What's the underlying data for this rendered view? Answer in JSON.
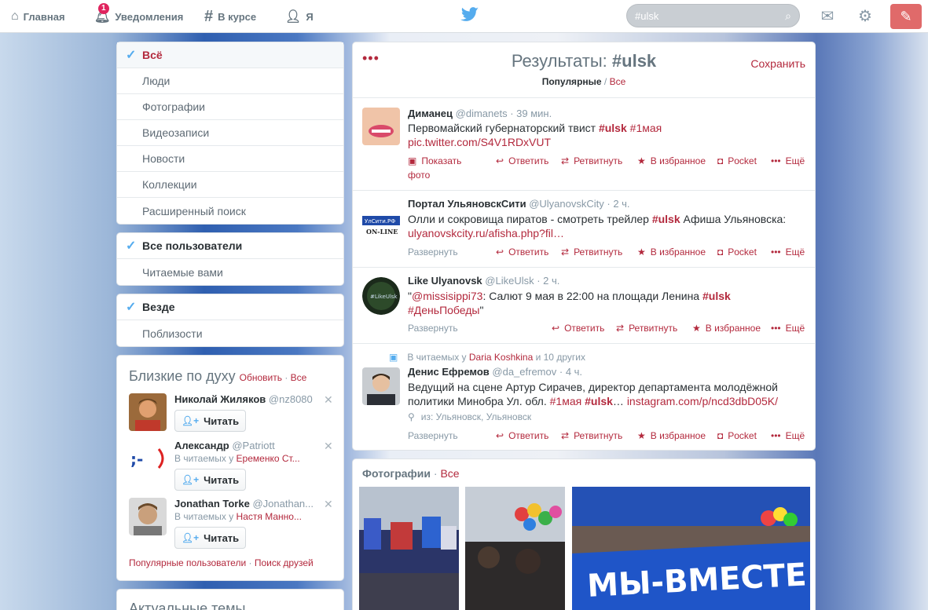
{
  "nav": {
    "home": "Главная",
    "notifications": "Уведомления",
    "notif_count": "1",
    "discover": "В курсе",
    "me": "Я",
    "search_value": "#ulsk"
  },
  "filters": {
    "type": [
      "Всё",
      "Люди",
      "Фотографии",
      "Видеозаписи",
      "Новости",
      "Коллекции",
      "Расширенный поиск"
    ],
    "people": [
      "Все пользователи",
      "Читаемые вами"
    ],
    "place": [
      "Везде",
      "Поблизости"
    ]
  },
  "wtf": {
    "title": "Близкие по духу",
    "refresh": "Обновить",
    "sep": " · ",
    "all": "Все",
    "follow": "Читать",
    "users": [
      {
        "name": "Николай Жиляков",
        "handle": "@nz8080",
        "ctx": ""
      },
      {
        "name": "Александр",
        "handle": "@Patriott",
        "ctx_prefix": "В читаемых у ",
        "ctx_name": "Еременко Ст..."
      },
      {
        "name": "Jonathan Torke",
        "handle": "@Jonathan...",
        "ctx_prefix": "В читаемых у ",
        "ctx_name": "Настя Манно..."
      }
    ],
    "footer_a": "Популярные пользователи",
    "footer_b": "Поиск друзей"
  },
  "trends_title": "Актуальные темы",
  "results": {
    "title": "Результаты: ",
    "query": "#ulsk",
    "save": "Сохранить",
    "top": "Популярные",
    "slash": " / ",
    "all": "Все"
  },
  "actions": {
    "reply": "Ответить",
    "retweet": "Ретвитнуть",
    "fav": "В избранное",
    "pocket": "Pocket",
    "more": "Ещё",
    "expand": "Развернуть",
    "show_photo": "Показать",
    "show_photo2": "фото"
  },
  "tweets": [
    {
      "name": "Диманец",
      "handle": "@dimanets",
      "time": "39 мин.",
      "text": "Первомайский губернаторский твист ",
      "tag1": "#ulsk",
      "tag2": "#1мая",
      "link": "pic.twitter.com/S4V1RDxVUT"
    },
    {
      "name": "Портал УльяновскСити",
      "handle": "@UlyanovskCity",
      "time": "2 ч.",
      "text": "Олли и сокровища пиратов - смотреть трейлер ",
      "tag1": "#ulsk",
      "text2": "  Афиша Ульяновска:",
      "link": "ulyanovskcity.ru/afisha.php?fil…"
    },
    {
      "name": "Like Ulyanovsk",
      "handle": "@LikeUlsk",
      "time": "2 ч.",
      "quote_open": "\"",
      "mention": "@missisippi73",
      "text": ": Салют 9 мая в 22:00 на площади Ленина ",
      "tag1": "#ulsk",
      "tag2": "#ДеньПобеды",
      "quote_close": "\""
    },
    {
      "ctx_prefix": "В читаемых у ",
      "ctx_name": "Daria Koshkina",
      "ctx_suffix": " и 10 других",
      "name": "Денис Ефремов",
      "handle": "@da_efremov",
      "time": "4 ч.",
      "text": "Ведущий на сцене Артур Сирачев, директор департамента молодёжной политики Минобра Ул. обл. ",
      "tag1": "#1мая",
      "tag2": "#ulsk",
      "ellipsis": "… ",
      "link": "instagram.com/p/ncd3dbD05K/",
      "place": "из: Ульяновск, Ульяновск"
    }
  ],
  "photos": {
    "title": "Фотографии",
    "sep": " · ",
    "all": "Все",
    "banner_text": "МЫ-ВМЕСТЕ"
  },
  "colors": {
    "accent": "#b3293d",
    "check": "#55acee"
  }
}
